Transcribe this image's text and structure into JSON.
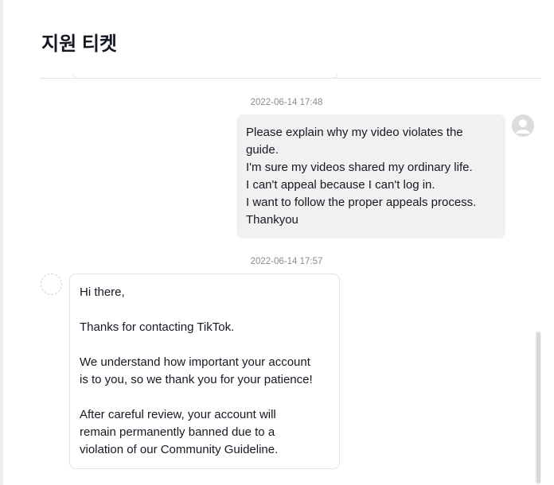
{
  "header": {
    "title": "지원 티켓"
  },
  "messages": [
    {
      "timestamp": "2022-06-14 17:48",
      "sender": "user",
      "lines": [
        "Please explain why my video violates the",
        "guide.",
        "I'm sure my videos shared my ordinary life.",
        "I can't appeal because I can't log in.",
        "I want to follow the proper appeals process.",
        "Thankyou"
      ]
    },
    {
      "timestamp": "2022-06-14 17:57",
      "sender": "support",
      "lines": [
        "Hi there,",
        "",
        "Thanks for contacting TikTok.",
        "",
        "We understand how important your account",
        "is to you, so we thank you for your patience!",
        "",
        "After careful review, your account will",
        "remain permanently banned due to a",
        "violation of our Community Guideline."
      ]
    }
  ],
  "colors": {
    "user_bubble_bg": "#f1f1f2",
    "support_bubble_border": "#e3e3e4",
    "timestamp": "#8a8b91",
    "text": "#161823"
  },
  "icons": {
    "user_avatar": "default-user-avatar-icon",
    "support_avatar": "support-avatar-icon"
  }
}
